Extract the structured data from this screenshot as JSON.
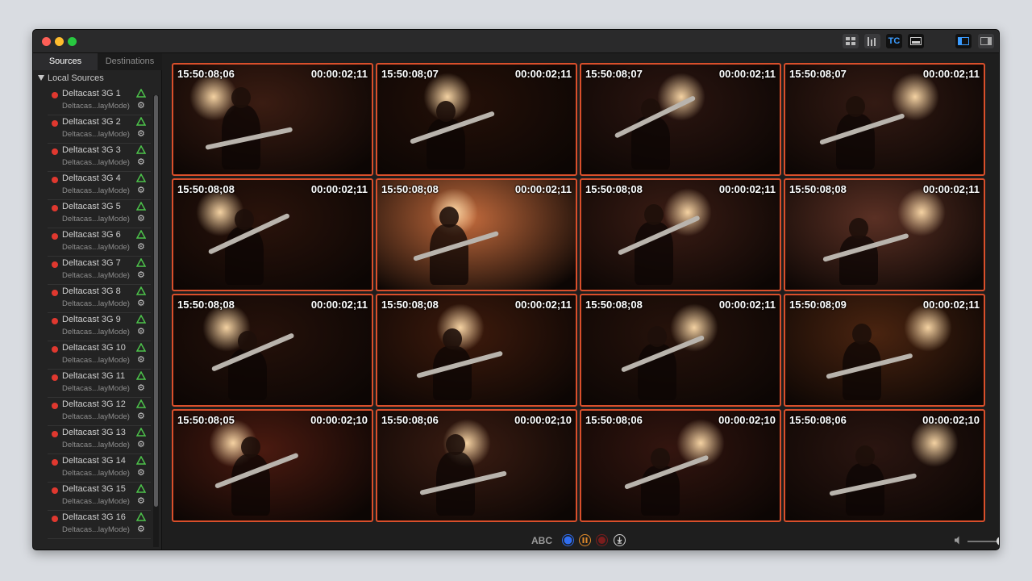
{
  "window": {
    "traffic_lights": [
      "close",
      "minimize",
      "maximize"
    ]
  },
  "toolbar": {
    "buttons": [
      {
        "icon": "grid-view-icon"
      },
      {
        "icon": "audio-meters-icon"
      },
      {
        "icon": "timecode-toggle",
        "label": "TC",
        "active": true
      },
      {
        "icon": "overlay-bar-icon"
      },
      {
        "icon": "sidebar-left-icon",
        "active": true
      },
      {
        "icon": "sidebar-right-icon"
      }
    ]
  },
  "sidebar": {
    "tabs": [
      {
        "label": "Sources",
        "selected": true
      },
      {
        "label": "Destinations",
        "selected": false
      }
    ],
    "group_label": "Local Sources",
    "sources": [
      {
        "name": "Deltacast 3G 1",
        "sub": "Deltacas...layMode)"
      },
      {
        "name": "Deltacast 3G 2",
        "sub": "Deltacas...layMode)"
      },
      {
        "name": "Deltacast 3G 3",
        "sub": "Deltacas...layMode)"
      },
      {
        "name": "Deltacast 3G 4",
        "sub": "Deltacas...layMode)"
      },
      {
        "name": "Deltacast 3G 5",
        "sub": "Deltacas...layMode)"
      },
      {
        "name": "Deltacast 3G 6",
        "sub": "Deltacas...layMode)"
      },
      {
        "name": "Deltacast 3G 7",
        "sub": "Deltacas...layMode)"
      },
      {
        "name": "Deltacast 3G 8",
        "sub": "Deltacas...layMode)"
      },
      {
        "name": "Deltacast 3G 9",
        "sub": "Deltacas...layMode)"
      },
      {
        "name": "Deltacast 3G 10",
        "sub": "Deltacas...layMode)"
      },
      {
        "name": "Deltacast 3G 11",
        "sub": "Deltacas...layMode)"
      },
      {
        "name": "Deltacast 3G 12",
        "sub": "Deltacas...layMode)"
      },
      {
        "name": "Deltacast 3G 13",
        "sub": "Deltacas...layMode)"
      },
      {
        "name": "Deltacast 3G 14",
        "sub": "Deltacas...layMode)"
      },
      {
        "name": "Deltacast 3G 15",
        "sub": "Deltacas...layMode)"
      },
      {
        "name": "Deltacast 3G 16",
        "sub": "Deltacas...layMode)"
      }
    ]
  },
  "tiles": [
    {
      "tc": "15:50:08;06",
      "dur": "00:00:02;11",
      "bg": "#3a1c12"
    },
    {
      "tc": "15:50:08;07",
      "dur": "00:00:02;11",
      "bg": "#241008"
    },
    {
      "tc": "15:50:08;07",
      "dur": "00:00:02;11",
      "bg": "#2b1510"
    },
    {
      "tc": "15:50:08;07",
      "dur": "00:00:02;11",
      "bg": "#331a13"
    },
    {
      "tc": "15:50:08;08",
      "dur": "00:00:02;11",
      "bg": "#2a130b"
    },
    {
      "tc": "15:50:08;08",
      "dur": "00:00:02;11",
      "bg": "#c26a3c"
    },
    {
      "tc": "15:50:08;08",
      "dur": "00:00:02;11",
      "bg": "#3a1c14"
    },
    {
      "tc": "15:50:08;08",
      "dur": "00:00:02;11",
      "bg": "#5a3024"
    },
    {
      "tc": "15:50:08;08",
      "dur": "00:00:02;11",
      "bg": "#25110a"
    },
    {
      "tc": "15:50:08;08",
      "dur": "00:00:02;11",
      "bg": "#3d1a0c"
    },
    {
      "tc": "15:50:08;08",
      "dur": "00:00:02;11",
      "bg": "#26120b"
    },
    {
      "tc": "15:50:08;09",
      "dur": "00:00:02;11",
      "bg": "#4a2410"
    },
    {
      "tc": "15:50:08;05",
      "dur": "00:00:02;10",
      "bg": "#4a1a10"
    },
    {
      "tc": "15:50:08;06",
      "dur": "00:00:02;10",
      "bg": "#3a1c12"
    },
    {
      "tc": "15:50:08;06",
      "dur": "00:00:02;10",
      "bg": "#33150f"
    },
    {
      "tc": "15:50:08;06",
      "dur": "00:00:02;10",
      "bg": "#2a1510"
    }
  ],
  "bottom_bar": {
    "label": "ABC",
    "controls": [
      {
        "icon": "record-blue-icon",
        "color": "#2f6df0"
      },
      {
        "icon": "pause-icon",
        "color": "#e08a2a"
      },
      {
        "icon": "stop-red-icon",
        "color": "#7a1d1d"
      },
      {
        "icon": "download-icon",
        "color": "#d0d0d0"
      }
    ],
    "volume": 0.9
  }
}
